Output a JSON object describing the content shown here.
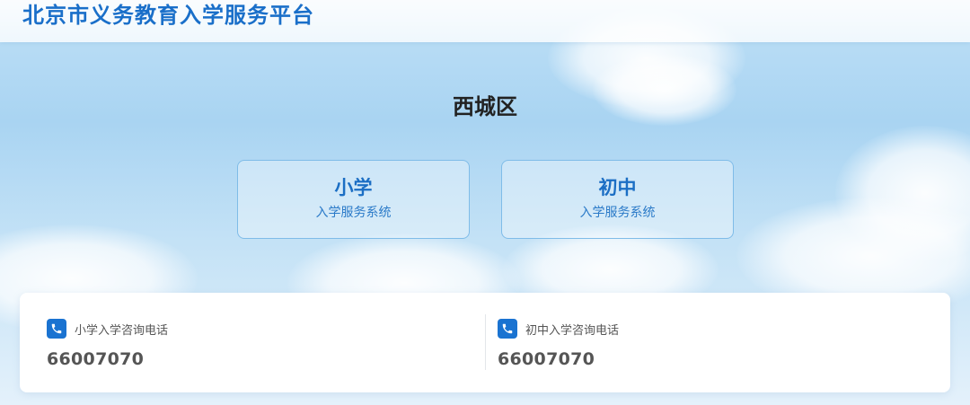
{
  "header": {
    "site_title": "北京市义务教育入学服务平台"
  },
  "main": {
    "district": "西城区",
    "cards": [
      {
        "title": "小学",
        "subtitle": "入学服务系统"
      },
      {
        "title": "初中",
        "subtitle": "入学服务系统"
      }
    ]
  },
  "contacts": [
    {
      "icon": "phone-icon",
      "label": "小学入学咨询电话",
      "number": "66007070"
    },
    {
      "icon": "phone-icon",
      "label": "初中入学咨询电话",
      "number": "66007070"
    }
  ],
  "colors": {
    "brand": "#1a6fc9",
    "card_border": "#7fbce8",
    "icon_bg": "#1a73d1"
  }
}
